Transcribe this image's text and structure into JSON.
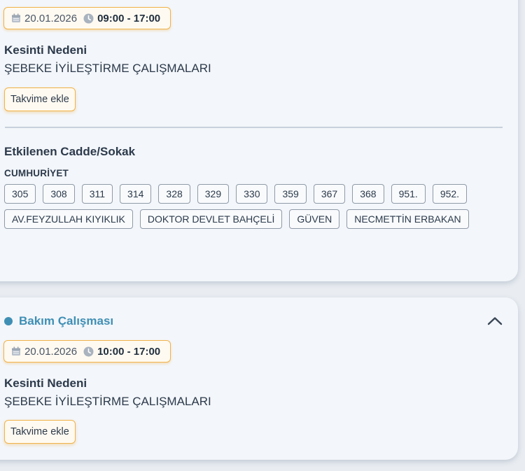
{
  "outage_1": {
    "date": "20.01.2026",
    "time": "09:00 - 17:00",
    "reason_label": "Kesinti Nedeni",
    "reason": "ŞEBEKE İYİLEŞTİRME ÇALIŞMALARI",
    "add_to_calendar": "Takvime ekle",
    "streets_label": "Etkilenen Cadde/Sokak",
    "area": "CUMHURİYET",
    "streets": [
      "305",
      "308",
      "311",
      "314",
      "328",
      "329",
      "330",
      "359",
      "367",
      "368",
      "951.",
      "952.",
      "AV.FEYZULLAH KIYIKLIK",
      "DOKTOR DEVLET BAHÇELİ",
      "GÜVEN",
      "NECMETTİN ERBAKAN"
    ]
  },
  "outage_2": {
    "status": "Bakım Çalışması",
    "status_color": "#3f8fb5",
    "date": "20.01.2026",
    "time": "10:00 - 17:00",
    "reason_label": "Kesinti Nedeni",
    "reason": "ŞEBEKE İYİLEŞTİRME ÇALIŞMALARI",
    "add_to_calendar": "Takvime ekle",
    "collapse_icon": "chevron-up-icon"
  },
  "colors": {
    "accent_orange": "#f0b24a",
    "status_blue": "#3f8fb5",
    "background": "#e9edf2",
    "card": "#f3f6fa"
  },
  "icons": {
    "date": "calendar-icon",
    "time": "clock-icon"
  }
}
